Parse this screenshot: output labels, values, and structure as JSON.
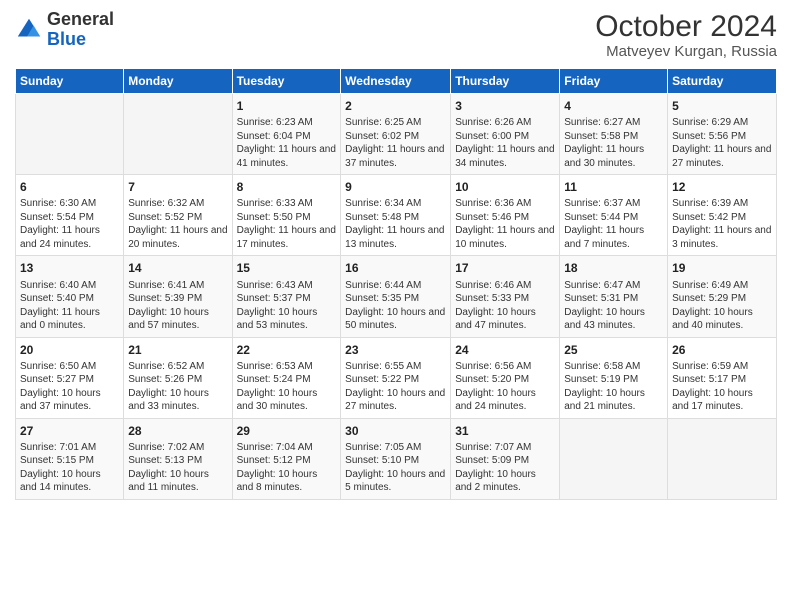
{
  "header": {
    "logo_general": "General",
    "logo_blue": "Blue",
    "month_title": "October 2024",
    "location": "Matveyev Kurgan, Russia"
  },
  "weekdays": [
    "Sunday",
    "Monday",
    "Tuesday",
    "Wednesday",
    "Thursday",
    "Friday",
    "Saturday"
  ],
  "rows": [
    [
      {
        "day": "",
        "text": ""
      },
      {
        "day": "",
        "text": ""
      },
      {
        "day": "1",
        "text": "Sunrise: 6:23 AM\nSunset: 6:04 PM\nDaylight: 11 hours and 41 minutes."
      },
      {
        "day": "2",
        "text": "Sunrise: 6:25 AM\nSunset: 6:02 PM\nDaylight: 11 hours and 37 minutes."
      },
      {
        "day": "3",
        "text": "Sunrise: 6:26 AM\nSunset: 6:00 PM\nDaylight: 11 hours and 34 minutes."
      },
      {
        "day": "4",
        "text": "Sunrise: 6:27 AM\nSunset: 5:58 PM\nDaylight: 11 hours and 30 minutes."
      },
      {
        "day": "5",
        "text": "Sunrise: 6:29 AM\nSunset: 5:56 PM\nDaylight: 11 hours and 27 minutes."
      }
    ],
    [
      {
        "day": "6",
        "text": "Sunrise: 6:30 AM\nSunset: 5:54 PM\nDaylight: 11 hours and 24 minutes."
      },
      {
        "day": "7",
        "text": "Sunrise: 6:32 AM\nSunset: 5:52 PM\nDaylight: 11 hours and 20 minutes."
      },
      {
        "day": "8",
        "text": "Sunrise: 6:33 AM\nSunset: 5:50 PM\nDaylight: 11 hours and 17 minutes."
      },
      {
        "day": "9",
        "text": "Sunrise: 6:34 AM\nSunset: 5:48 PM\nDaylight: 11 hours and 13 minutes."
      },
      {
        "day": "10",
        "text": "Sunrise: 6:36 AM\nSunset: 5:46 PM\nDaylight: 11 hours and 10 minutes."
      },
      {
        "day": "11",
        "text": "Sunrise: 6:37 AM\nSunset: 5:44 PM\nDaylight: 11 hours and 7 minutes."
      },
      {
        "day": "12",
        "text": "Sunrise: 6:39 AM\nSunset: 5:42 PM\nDaylight: 11 hours and 3 minutes."
      }
    ],
    [
      {
        "day": "13",
        "text": "Sunrise: 6:40 AM\nSunset: 5:40 PM\nDaylight: 11 hours and 0 minutes."
      },
      {
        "day": "14",
        "text": "Sunrise: 6:41 AM\nSunset: 5:39 PM\nDaylight: 10 hours and 57 minutes."
      },
      {
        "day": "15",
        "text": "Sunrise: 6:43 AM\nSunset: 5:37 PM\nDaylight: 10 hours and 53 minutes."
      },
      {
        "day": "16",
        "text": "Sunrise: 6:44 AM\nSunset: 5:35 PM\nDaylight: 10 hours and 50 minutes."
      },
      {
        "day": "17",
        "text": "Sunrise: 6:46 AM\nSunset: 5:33 PM\nDaylight: 10 hours and 47 minutes."
      },
      {
        "day": "18",
        "text": "Sunrise: 6:47 AM\nSunset: 5:31 PM\nDaylight: 10 hours and 43 minutes."
      },
      {
        "day": "19",
        "text": "Sunrise: 6:49 AM\nSunset: 5:29 PM\nDaylight: 10 hours and 40 minutes."
      }
    ],
    [
      {
        "day": "20",
        "text": "Sunrise: 6:50 AM\nSunset: 5:27 PM\nDaylight: 10 hours and 37 minutes."
      },
      {
        "day": "21",
        "text": "Sunrise: 6:52 AM\nSunset: 5:26 PM\nDaylight: 10 hours and 33 minutes."
      },
      {
        "day": "22",
        "text": "Sunrise: 6:53 AM\nSunset: 5:24 PM\nDaylight: 10 hours and 30 minutes."
      },
      {
        "day": "23",
        "text": "Sunrise: 6:55 AM\nSunset: 5:22 PM\nDaylight: 10 hours and 27 minutes."
      },
      {
        "day": "24",
        "text": "Sunrise: 6:56 AM\nSunset: 5:20 PM\nDaylight: 10 hours and 24 minutes."
      },
      {
        "day": "25",
        "text": "Sunrise: 6:58 AM\nSunset: 5:19 PM\nDaylight: 10 hours and 21 minutes."
      },
      {
        "day": "26",
        "text": "Sunrise: 6:59 AM\nSunset: 5:17 PM\nDaylight: 10 hours and 17 minutes."
      }
    ],
    [
      {
        "day": "27",
        "text": "Sunrise: 7:01 AM\nSunset: 5:15 PM\nDaylight: 10 hours and 14 minutes."
      },
      {
        "day": "28",
        "text": "Sunrise: 7:02 AM\nSunset: 5:13 PM\nDaylight: 10 hours and 11 minutes."
      },
      {
        "day": "29",
        "text": "Sunrise: 7:04 AM\nSunset: 5:12 PM\nDaylight: 10 hours and 8 minutes."
      },
      {
        "day": "30",
        "text": "Sunrise: 7:05 AM\nSunset: 5:10 PM\nDaylight: 10 hours and 5 minutes."
      },
      {
        "day": "31",
        "text": "Sunrise: 7:07 AM\nSunset: 5:09 PM\nDaylight: 10 hours and 2 minutes."
      },
      {
        "day": "",
        "text": ""
      },
      {
        "day": "",
        "text": ""
      }
    ]
  ]
}
